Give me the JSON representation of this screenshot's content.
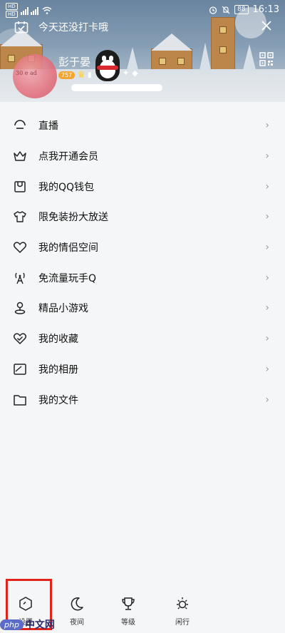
{
  "status_bar": {
    "sim_chips": [
      "HD",
      "HD"
    ],
    "signal_label": "4G",
    "battery": "88",
    "time": "16:13"
  },
  "header": {
    "checkin_text": "今天还没打卡哦",
    "nickname": "彭于晏",
    "level": "757",
    "avatar_text": "30 e ad"
  },
  "menu": {
    "items": [
      {
        "label": "直播",
        "icon": "live-icon"
      },
      {
        "label": "点我开通会员",
        "icon": "crown-icon"
      },
      {
        "label": "我的QQ钱包",
        "icon": "wallet-icon"
      },
      {
        "label": "限免装扮大放送",
        "icon": "tshirt-icon"
      },
      {
        "label": "我的情侣空间",
        "icon": "heart-icon"
      },
      {
        "label": "免流量玩手Q",
        "icon": "signal-tower-icon"
      },
      {
        "label": "精品小游戏",
        "icon": "joystick-icon"
      },
      {
        "label": "我的收藏",
        "icon": "favorite-heart-icon"
      },
      {
        "label": "我的相册",
        "icon": "album-icon"
      },
      {
        "label": "我的文件",
        "icon": "folder-icon"
      }
    ],
    "chevron": "›"
  },
  "bottom_bar": {
    "items": [
      {
        "label": "设置",
        "icon": "settings-shield-icon"
      },
      {
        "label": "夜间",
        "icon": "moon-icon"
      },
      {
        "label": "等级",
        "icon": "trophy-icon"
      },
      {
        "label": "闲行",
        "icon": "sun-icon"
      }
    ]
  },
  "watermark": {
    "logo": "php",
    "text": "中文网"
  },
  "colors": {
    "accent_red": "#e2231a",
    "text": "#111111",
    "chevron": "#9a9a9a"
  }
}
